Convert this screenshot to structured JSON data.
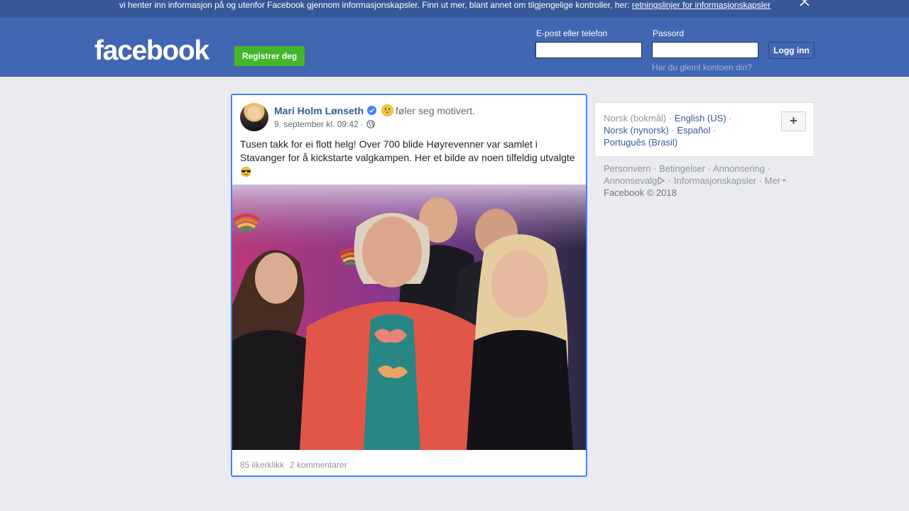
{
  "cookie_banner": {
    "text": "vi henter inn informasjon på og utenfor Facebook gjennom informasjonskapsler. Finn ut mer, blant annet om tilgjengelige kontroller, her: ",
    "link": "retningslinjer for informasjonskapsler",
    "close_icon": "close-icon"
  },
  "header": {
    "logo": "facebook",
    "register_label": "Registrer deg",
    "email_label": "E-post eller telefon",
    "email_value": "",
    "password_label": "Passord",
    "password_value": "",
    "login_label": "Logg inn",
    "forgot_label": "Har du glemt kontoen din?"
  },
  "post": {
    "author": "Mari Holm Lønseth",
    "verified_icon": "verified-badge-icon",
    "feeling_icon": "grinning-face-emoji",
    "feeling_text": "føler seg motivert.",
    "timestamp": "9. september kl. 09:42 ·",
    "audience_icon": "globe-icon",
    "text": "Tusen takk for ei flott helg! Over 700 blide Høyrevenner var samlet i Stavanger for å kickstarte valgkampen. Her et bilde av noen tilfeldig utvalgte",
    "text_emoji": "sunglasses-emoji",
    "likes": "85 likerklikk",
    "comments": "2 kommentarer"
  },
  "languages": {
    "items": [
      {
        "label": "Norsk (bokmål)",
        "current": true
      },
      {
        "label": "English (US)",
        "current": false
      },
      {
        "label": "Norsk (nynorsk)",
        "current": false
      },
      {
        "label": "Español",
        "current": false
      },
      {
        "label": "Português (Brasil)",
        "current": false
      }
    ],
    "separator": "·",
    "more_label": "+"
  },
  "footer": {
    "links": [
      "Personvern",
      "Betingelser",
      "Annonsering",
      "Annonsevalg",
      "Informasjonskapsler",
      "Mer"
    ],
    "copyright": "Facebook © 2018"
  },
  "colors": {
    "brand": "#4267b2",
    "banner": "#365899",
    "link": "#385898",
    "register": "#42b72a",
    "focus_border": "#4080ff"
  }
}
